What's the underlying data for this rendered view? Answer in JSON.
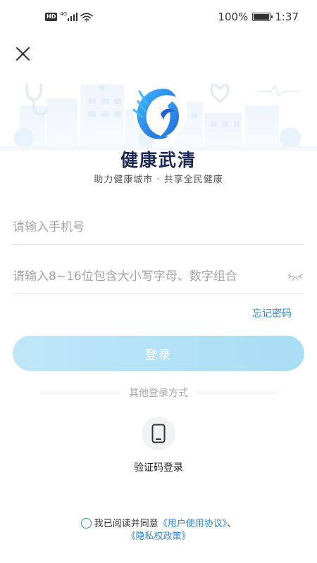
{
  "status_bar": {
    "hd_label": "HD",
    "network_label": "4G",
    "battery_percent": "100%",
    "battery_level": 1.0,
    "time": "1:37"
  },
  "brand": {
    "title": "健康武清",
    "slogan": "助力健康城市 · 共享全民健康",
    "primary_color": "#1b2a55",
    "accent_color": "#2a84e0"
  },
  "form": {
    "phone_placeholder": "请输入手机号",
    "phone_value": "",
    "password_placeholder": "请输入8~16位包含大小写字母、数字组合",
    "password_value": "",
    "forgot_password": "忘记密码",
    "login_button": "登录"
  },
  "other_login": {
    "label": "其他登录方式",
    "sms_label": "验证码登录",
    "sms_icon": "phone-icon"
  },
  "agreement": {
    "prefix": "我已阅读并同意",
    "user_agreement": "《用户使用协议》",
    "separator": "、",
    "privacy_policy": "《隐私权政策》",
    "checked": false
  }
}
